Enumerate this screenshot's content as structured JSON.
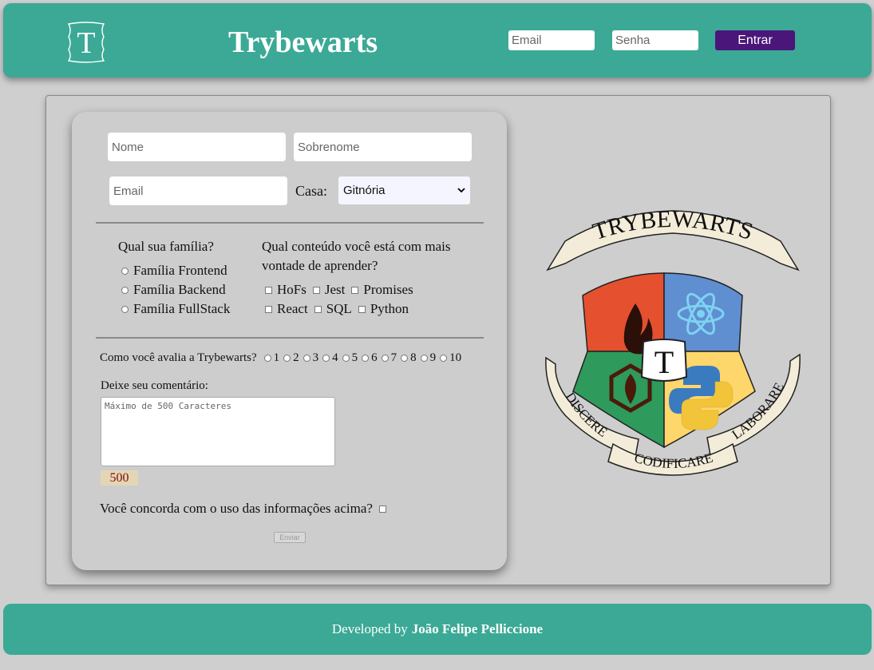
{
  "header": {
    "logo_letter": "T",
    "title": "Trybewarts",
    "email_placeholder": "Email",
    "password_placeholder": "Senha",
    "login_button": "Entrar"
  },
  "form": {
    "first_name_placeholder": "Nome",
    "last_name_placeholder": "Sobrenome",
    "email_placeholder": "Email",
    "house_label": "Casa:",
    "house_selected": "Gitnória",
    "family_question": "Qual sua família?",
    "families": [
      "Família Frontend",
      "Família Backend",
      "Família FullStack"
    ],
    "content_question": "Qual conteúdo você está com mais vontade de aprender?",
    "content_row1": [
      "HoFs",
      "Jest",
      "Promises"
    ],
    "content_row2": [
      "React",
      "SQL",
      "Python"
    ],
    "rating_question": "Como você avalia a Trybewarts?",
    "ratings": [
      "1",
      "2",
      "3",
      "4",
      "5",
      "6",
      "7",
      "8",
      "9",
      "10"
    ],
    "comment_label": "Deixe seu comentário:",
    "comment_placeholder": "Máximo de 500 Caracteres",
    "counter": "500",
    "agreement": "Você concorda com o uso das informações acima?",
    "submit_label": "Enviar"
  },
  "crest": {
    "banner_top": "TRYBEWARTS",
    "center_letter": "T",
    "banner_left": "DISCERE",
    "banner_bottom": "CODIFICARE",
    "banner_right": "LABORARE",
    "colors": {
      "red": "#e5502f",
      "blue": "#5f8fd0",
      "green": "#2e9a5c",
      "yellow": "#fdd66c",
      "parchment": "#f3ecd9"
    }
  },
  "footer": {
    "prefix": "Developed by",
    "author": "João Felipe Pelliccione"
  },
  "colors": {
    "teal": "#3ba995",
    "purple": "#4a167a",
    "background": "#cfcfcf"
  }
}
